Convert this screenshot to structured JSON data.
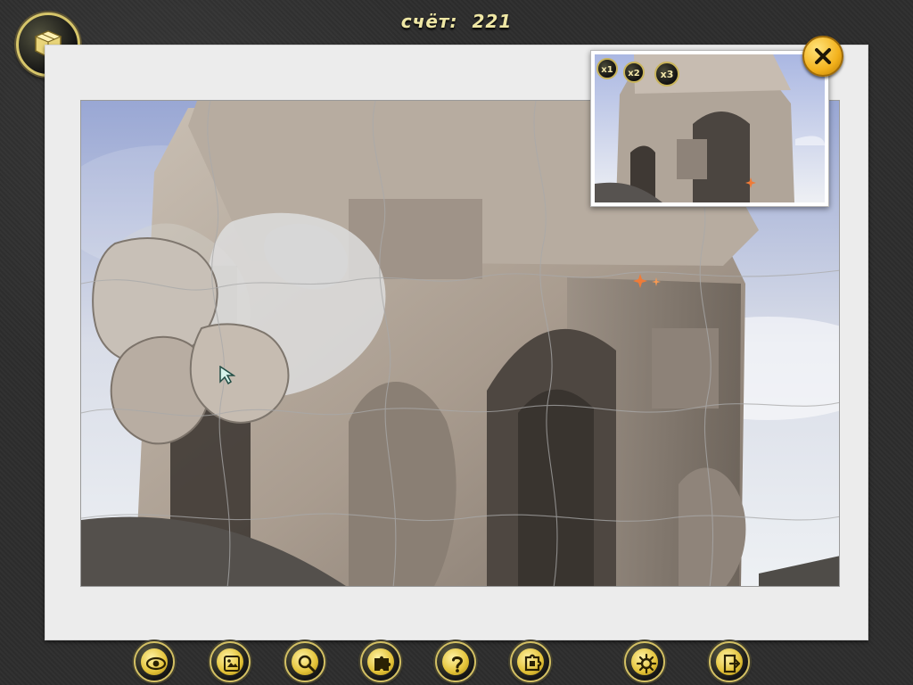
{
  "header": {
    "score_label": "счёт:",
    "score_value": "221"
  },
  "preview": {
    "zoom_1": "x1",
    "zoom_2": "x2",
    "zoom_3": "x3"
  },
  "toolbar": {
    "buttons": [
      "eye-icon",
      "photo-icon",
      "magnifier-icon",
      "puzzle-pieces-icon",
      "question-icon",
      "piece-icon",
      "gear-icon",
      "exit-icon"
    ]
  },
  "colors": {
    "gold": "#d2bf63",
    "score_text": "#efe7a5",
    "close_button": "#f3b21d",
    "board_border": "#ececec"
  }
}
